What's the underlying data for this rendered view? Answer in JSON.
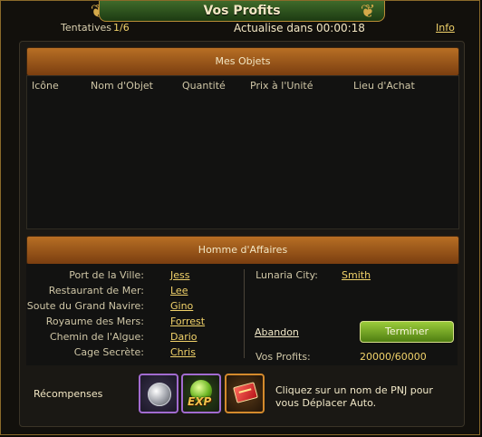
{
  "window": {
    "title": "Vos Profits",
    "attempts_label": "Tentatives",
    "attempts_value": "1/6",
    "update_text": "Actualise dans 00:00:18",
    "info_link": "Info"
  },
  "objects": {
    "header": "Mes Objets",
    "columns": [
      "Icône",
      "Nom d'Objet",
      "Quantité",
      "Prix à l'Unité",
      "Lieu d'Achat"
    ],
    "rows": []
  },
  "merchant": {
    "header": "Homme d'Affaires",
    "locations": [
      {
        "place": "Port de la Ville:",
        "npc": "Jess"
      },
      {
        "place": "Restaurant de Mer:",
        "npc": "Lee"
      },
      {
        "place": "Soute du Grand Navire:",
        "npc": "Gino"
      },
      {
        "place": "Royaume des Mers:",
        "npc": "Forrest"
      },
      {
        "place": "Chemin de l'Algue:",
        "npc": "Dario"
      },
      {
        "place": "Cage Secrète:",
        "npc": "Chris"
      }
    ],
    "right_location": {
      "place": "Lunaria City:",
      "npc": "Smith"
    },
    "abandon_label": "Abandon",
    "finish_label": "Terminer",
    "profits_label": "Vos Profits:",
    "profits_value": "20000/60000"
  },
  "rewards": {
    "label": "Récompenses",
    "items": [
      "silver-coin-icon",
      "exp-orb-icon",
      "red-card-icon"
    ],
    "exp_text": "EXP",
    "hint": "Cliquez sur un nom de PNJ pour vous Déplacer Auto."
  }
}
